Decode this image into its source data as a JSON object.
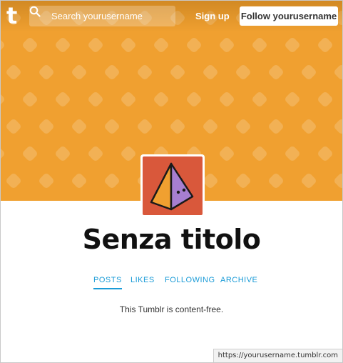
{
  "header": {
    "logo_text": "t",
    "search_placeholder": "Search yourusername",
    "signup_label": "Sign up",
    "follow_label": "Follow yourusername",
    "banner_color": "#f0a030"
  },
  "blog": {
    "title": "Senza titolo",
    "avatar_bg_color": "#d9583b",
    "empty_message": "This Tumblr is content-free."
  },
  "nav": {
    "items": [
      {
        "label": "POSTS",
        "active": true
      },
      {
        "label": "LIKES",
        "active": false
      },
      {
        "label": "FOLLOWING",
        "active": false
      },
      {
        "label": "ARCHIVE",
        "active": false
      }
    ]
  },
  "status_bar": {
    "url": "https://yourusername.tumblr.com"
  }
}
